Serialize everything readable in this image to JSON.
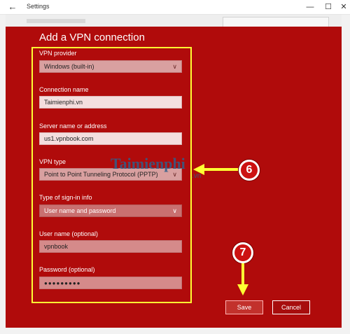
{
  "window": {
    "title": "Settings",
    "back_glyph": "←",
    "minimize_glyph": "—",
    "maximize_glyph": "☐",
    "close_glyph": "✕"
  },
  "dialog": {
    "title": "Add a VPN connection",
    "vpn_provider": {
      "label": "VPN provider",
      "value": "Windows (built-in)"
    },
    "connection_name": {
      "label": "Connection name",
      "value": "Taimienphi.vn"
    },
    "server": {
      "label": "Server name or address",
      "value": "us1.vpnbook.com"
    },
    "vpn_type": {
      "label": "VPN type",
      "value": "Point to Point Tunneling Protocol (PPTP)"
    },
    "sign_in": {
      "label": "Type of sign-in info",
      "value": "User name and password"
    },
    "username": {
      "label": "User name (optional)",
      "value": "vpnbook"
    },
    "password": {
      "label": "Password (optional)",
      "value": "●●●●●●●●●"
    },
    "save_label": "Save",
    "cancel_label": "Cancel"
  },
  "annotations": {
    "step6": "6",
    "step7": "7",
    "watermark": "Taimienphi",
    "watermark_sub": ".vn"
  },
  "colors": {
    "dialog_bg": "#b00b0b",
    "highlight": "#ffff33",
    "badge": "#cc1111"
  }
}
